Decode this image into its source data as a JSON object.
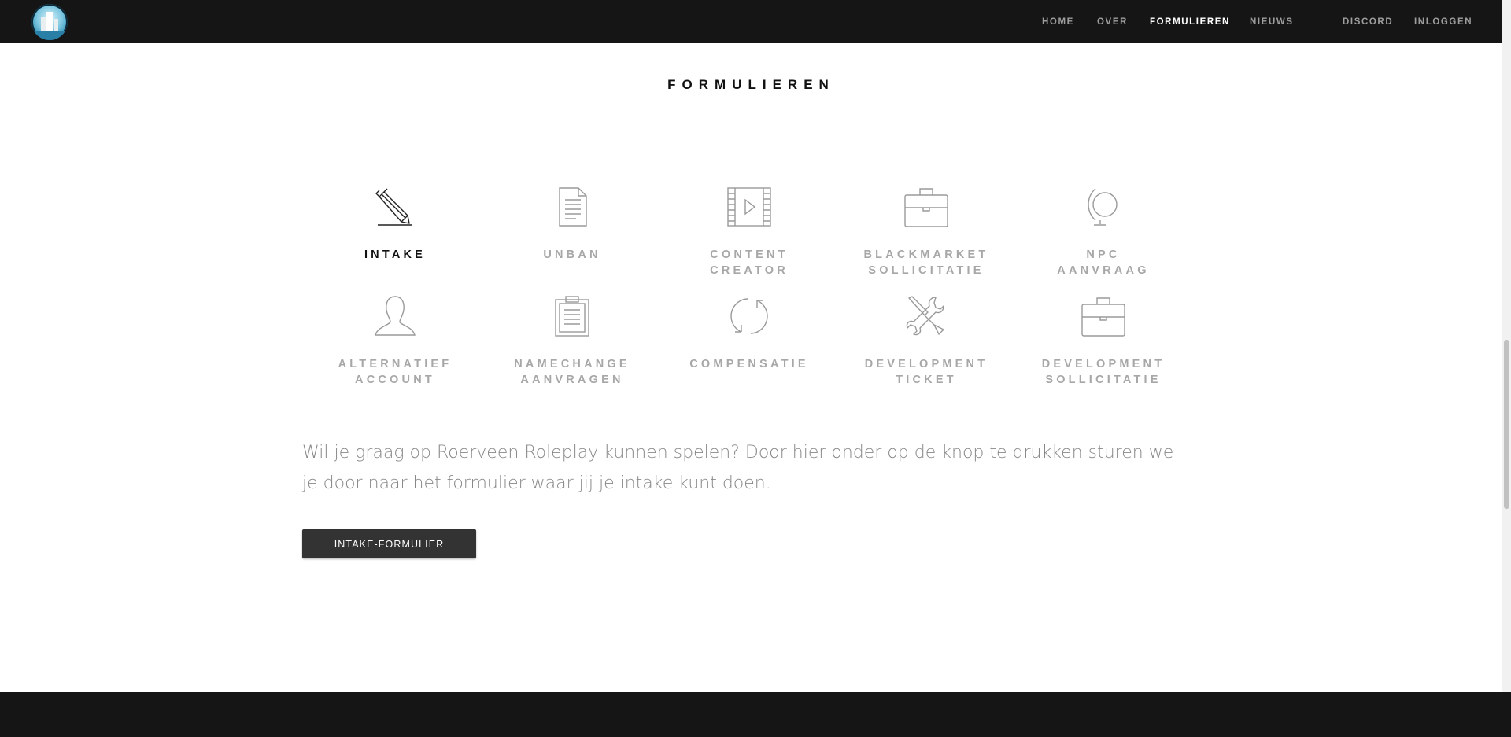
{
  "nav": {
    "items": [
      {
        "label": "HOME"
      },
      {
        "label": "OVER"
      },
      {
        "label": "FORMULIEREN"
      },
      {
        "label": "NIEUWS"
      },
      {
        "label": "DISCORD"
      },
      {
        "label": "INLOGGEN"
      }
    ],
    "active": "FORMULIEREN"
  },
  "section": {
    "title": "FORMULIEREN"
  },
  "forms": [
    {
      "line1": "INTAKE",
      "line2": "",
      "icon": "pencil-icon",
      "active": true
    },
    {
      "line1": "UNBAN",
      "line2": "",
      "icon": "document-icon"
    },
    {
      "line1": "CONTENT",
      "line2": "CREATOR",
      "icon": "film-icon"
    },
    {
      "line1": "BLACKMARKET",
      "line2": "SOLLICITATIE",
      "icon": "briefcase-icon"
    },
    {
      "line1": "NPC",
      "line2": "AANVRAAG",
      "icon": "globe-icon"
    },
    {
      "line1": "ALTERNATIEF",
      "line2": "ACCOUNT",
      "icon": "user-icon"
    },
    {
      "line1": "NAMECHANGE",
      "line2": "AANVRAGEN",
      "icon": "clipboard-icon"
    },
    {
      "line1": "COMPENSATIE",
      "line2": "",
      "icon": "refresh-icon"
    },
    {
      "line1": "DEVELOPMENT",
      "line2": "TICKET",
      "icon": "tools-icon"
    },
    {
      "line1": "DEVELOPMENT",
      "line2": "SOLLICITATIE",
      "icon": "briefcase-icon"
    }
  ],
  "content": {
    "description": "Wil je graag op Roerveen Roleplay kunnen spelen? Door hier onder op de knop te drukken sturen we je door naar het formulier waar jij je intake kunt doen.",
    "button_label": "INTAKE-FORMULIER"
  },
  "colors": {
    "topbar": "#151515",
    "nav_text": "#9e9e9e",
    "nav_active": "#ffffff",
    "label_inactive": "#a7a7a7",
    "label_active": "#111111",
    "button_bg": "#333333"
  }
}
